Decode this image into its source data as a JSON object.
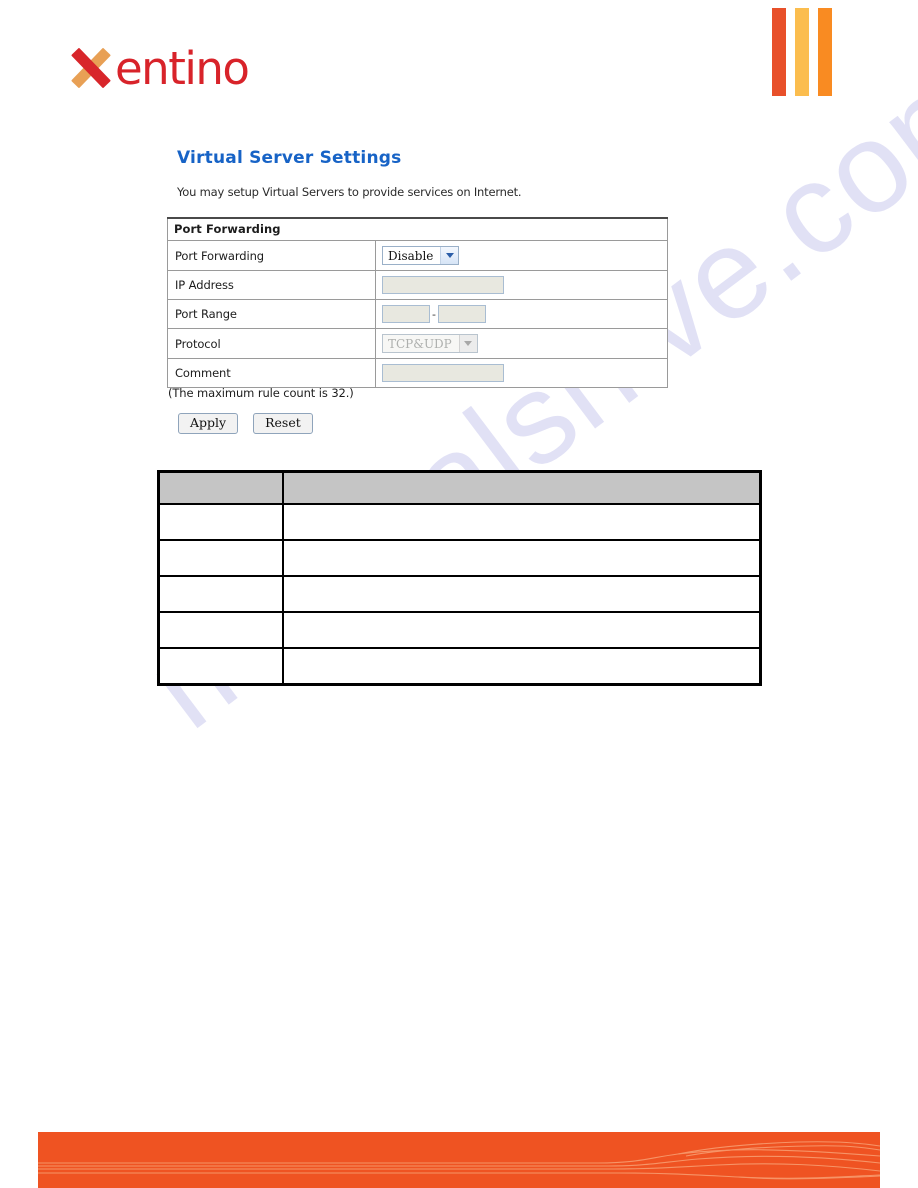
{
  "brand": {
    "name": "entino",
    "logo_mark": "x-mark",
    "color_primary": "#d8232a",
    "color_secondary": "#e8a055"
  },
  "header": {
    "bars": [
      {
        "name": "bar-red-orange",
        "color": "#e8502a"
      },
      {
        "name": "bar-light-orange",
        "color": "#fbbd4e"
      },
      {
        "name": "bar-orange",
        "color": "#f98b22"
      }
    ]
  },
  "page": {
    "title": "Virtual Server Settings",
    "subtitle": "You may setup Virtual Servers to provide services on Internet.",
    "title_color": "#1763c6"
  },
  "settings_panel": {
    "header_label": "Port Forwarding",
    "header_bg": "#83b2f4",
    "rows": [
      {
        "label": "Port Forwarding",
        "control": "select",
        "value": "Disable",
        "disabled": false
      },
      {
        "label": "IP Address",
        "control": "text",
        "value": "",
        "disabled": true
      },
      {
        "label": "Port Range",
        "control": "range",
        "value_start": "",
        "value_end": "",
        "separator": "-",
        "disabled": true
      },
      {
        "label": "Protocol",
        "control": "select",
        "value": "TCP&UDP",
        "disabled": true
      },
      {
        "label": "Comment",
        "control": "text",
        "value": "",
        "disabled": true
      }
    ],
    "note": "(The maximum rule count is 32.)"
  },
  "actions": {
    "apply_label": "Apply",
    "reset_label": "Reset"
  },
  "description_table": {
    "header": [
      "",
      ""
    ],
    "rows": [
      [
        "",
        ""
      ],
      [
        "",
        ""
      ],
      [
        "",
        ""
      ],
      [
        "",
        ""
      ],
      [
        "",
        ""
      ]
    ],
    "header_bg": "#c5c5c5"
  },
  "watermark": {
    "text": "manualshive.com",
    "color": "#c9c9ee"
  },
  "footer": {
    "color": "#ef5322"
  }
}
